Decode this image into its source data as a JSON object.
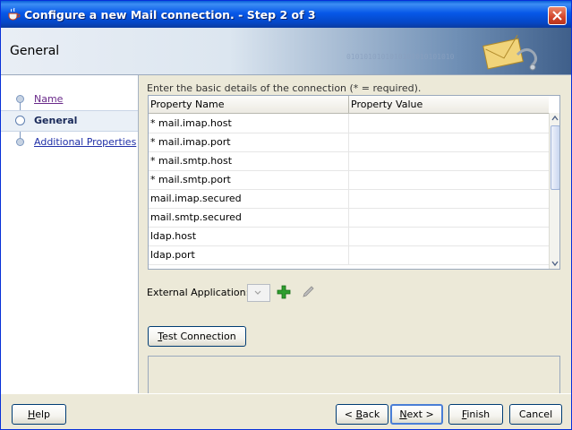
{
  "window": {
    "title": "Configure a new Mail connection. - Step 2 of 3"
  },
  "header": {
    "title": "General",
    "decoration": "0101010101010101010101010"
  },
  "nav": {
    "items": [
      {
        "label": "Name",
        "state": "visited-link"
      },
      {
        "label": "General",
        "state": "current"
      },
      {
        "label": "Additional Properties",
        "state": "link"
      }
    ]
  },
  "content": {
    "instruction": "Enter the basic details of the connection (* = required).",
    "table": {
      "columns": [
        "Property Name",
        "Property Value"
      ],
      "rows": [
        {
          "name": "* mail.imap.host",
          "value": ""
        },
        {
          "name": "* mail.imap.port",
          "value": ""
        },
        {
          "name": "* mail.smtp.host",
          "value": ""
        },
        {
          "name": "* mail.smtp.port",
          "value": ""
        },
        {
          "name": "mail.imap.secured",
          "value": ""
        },
        {
          "name": "mail.smtp.secured",
          "value": ""
        },
        {
          "name": "ldap.host",
          "value": ""
        },
        {
          "name": "ldap.port",
          "value": ""
        }
      ]
    },
    "external_application_label": "External Application:",
    "test_connection": {
      "mnemonic": "T",
      "rest": "est Connection"
    }
  },
  "footer": {
    "help": {
      "mnemonic": "H",
      "rest": "elp"
    },
    "back": {
      "prefix": "< ",
      "mnemonic": "B",
      "rest": "ack"
    },
    "next": {
      "mnemonic": "N",
      "rest": "ext >"
    },
    "finish": {
      "mnemonic": "F",
      "rest": "inish"
    },
    "cancel": "Cancel"
  },
  "colors": {
    "titlebar": "#0758e8",
    "nav_link": "#2030a8",
    "add_icon": "#2e9e2e"
  }
}
